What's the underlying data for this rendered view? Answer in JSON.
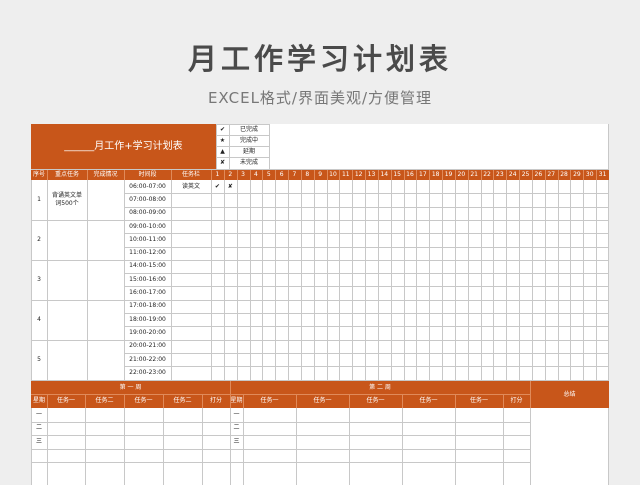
{
  "page": {
    "title": "月工作学习计划表",
    "subtitle": "EXCEL格式/界面美观/方便管理"
  },
  "sheet": {
    "header_title": "______月工作+学习计划表",
    "legend": [
      {
        "symbol": "✔",
        "label": "已完成"
      },
      {
        "symbol": "★",
        "label": "完成中"
      },
      {
        "symbol": "▲",
        "label": "延期"
      },
      {
        "symbol": "✘",
        "label": "未完成"
      }
    ],
    "columns": [
      "序号",
      "重点任务",
      "完成情况",
      "时间段",
      "任务栏"
    ],
    "days": [
      "1",
      "2",
      "3",
      "4",
      "5",
      "6",
      "7",
      "8",
      "9",
      "10",
      "11",
      "12",
      "13",
      "14",
      "15",
      "16",
      "17",
      "18",
      "19",
      "20",
      "21",
      "22",
      "23",
      "24",
      "25",
      "26",
      "27",
      "28",
      "29",
      "30",
      "31"
    ],
    "groups": [
      {
        "num": "1",
        "task": "背诵英文单词500个",
        "time_slots": [
          "06:00-07:00",
          "07:00-08:00",
          "08:00-09:00"
        ]
      },
      {
        "num": "2",
        "task": "",
        "time_slots": [
          "09:00-10:00",
          "10:00-11:00",
          "11:00-12:00"
        ]
      },
      {
        "num": "3",
        "task": "",
        "time_slots": [
          "14:00-15:00",
          "15:00-16:00",
          "16:00-17:00"
        ]
      },
      {
        "num": "4",
        "task": "",
        "time_slots": [
          "17:00-18:00",
          "18:00-19:00",
          "19:00-20:00"
        ]
      },
      {
        "num": "5",
        "task": "",
        "time_slots": [
          "20:00-21:00",
          "21:00-22:00",
          "22:00-23:00"
        ]
      }
    ],
    "first_row_task": "读英文",
    "first_row_marks": [
      "✔",
      "✘"
    ],
    "weekly": {
      "week1_label": "第 一 周",
      "week2_label": "第 二 周",
      "summary_label": "总结",
      "week1_columns": [
        "星期",
        "任务一",
        "任务二",
        "任务一",
        "任务二",
        "打分"
      ],
      "week2_columns": [
        "星期",
        "任务一",
        "任务一",
        "任务一",
        "任务一",
        "任务一",
        "打分"
      ],
      "weekdays": [
        "一",
        "二",
        "三"
      ]
    }
  },
  "colors": {
    "accent": "#c8561a",
    "background": "#eeeeee",
    "grid": "#c8c8c8"
  }
}
